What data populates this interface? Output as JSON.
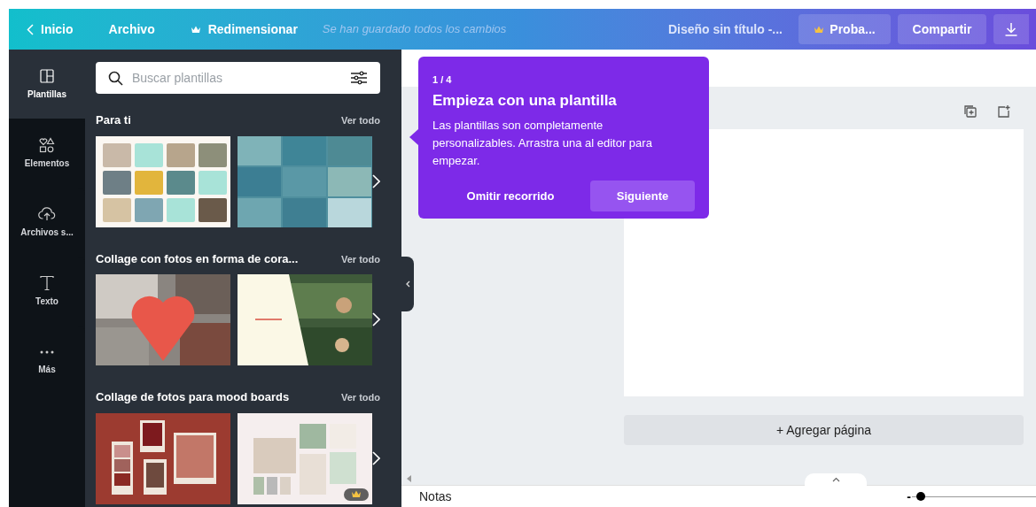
{
  "top_bar": {
    "nav": [
      {
        "label": "Inicio",
        "kind": "back"
      },
      {
        "label": "Archivo",
        "kind": "plain"
      },
      {
        "label": "Redimensionar",
        "kind": "premium"
      }
    ],
    "save_status": "Se han guardado todos los cambios",
    "design_title": "Diseño sin título -...",
    "buttons": [
      {
        "label": "Proba...",
        "kind": "premium"
      },
      {
        "label": "Compartir",
        "kind": "plain"
      },
      {
        "kind": "download"
      }
    ]
  },
  "sidebar": {
    "items": [
      {
        "label": "Plantillas",
        "selected": true
      },
      {
        "label": "Elementos",
        "selected": false
      },
      {
        "label": "Archivos s...",
        "selected": false
      },
      {
        "label": "Texto",
        "selected": false
      },
      {
        "label": "Más",
        "selected": false
      }
    ]
  },
  "panel": {
    "search": {
      "placeholder": "Buscar plantillas"
    },
    "sections": [
      {
        "title": "Para ti",
        "link": "Ver todo",
        "thumbnails": [
          {
            "premium": false
          },
          {
            "premium": false
          }
        ]
      },
      {
        "title": "Collage con fotos en forma de cora...",
        "link": "Ver todo",
        "thumbnails": [
          {
            "premium": false
          },
          {
            "premium": false
          }
        ]
      },
      {
        "title": "Collage de fotos para mood boards",
        "link": "Ver todo",
        "thumbnails": [
          {
            "premium": false
          },
          {
            "premium": true
          }
        ]
      }
    ]
  },
  "tour": {
    "step": "1 / 4",
    "title": "Empieza con una plantilla",
    "text": "Las plantillas son completamente personalizables. Arrastra una al editor para empezar.",
    "buttons": [
      {
        "label": "Omitir recorrido",
        "kind": "secondary"
      },
      {
        "label": "Siguiente",
        "kind": "primary"
      }
    ]
  },
  "canvas": {
    "add_page": "+ Agregar página"
  },
  "footer": {
    "notes": "Notas",
    "zoom_minus": "-",
    "zoom": {
      "level": 0.04
    }
  }
}
